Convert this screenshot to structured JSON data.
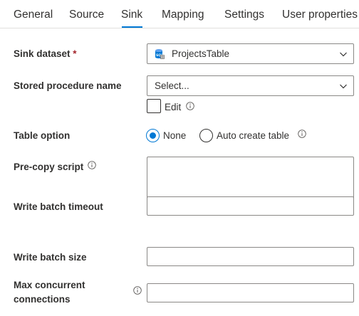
{
  "tabs": [
    {
      "label": "General"
    },
    {
      "label": "Source"
    },
    {
      "label": "Sink"
    },
    {
      "label": "Mapping"
    },
    {
      "label": "Settings"
    },
    {
      "label": "User properties"
    }
  ],
  "active_tab": "Sink",
  "accent_color": "#0078d4",
  "sink_dataset": {
    "label": "Sink dataset",
    "required_marker": "*",
    "value": "ProjectsTable",
    "icon": "sql-table-icon"
  },
  "stored_procedure": {
    "label": "Stored procedure name",
    "placeholder": "Select...",
    "edit_label": "Edit",
    "edit_checked": false
  },
  "table_option": {
    "label": "Table option",
    "options": [
      {
        "label": "None",
        "selected": true
      },
      {
        "label": "Auto create table",
        "selected": false
      }
    ]
  },
  "pre_copy_script": {
    "label": "Pre-copy script",
    "value": ""
  },
  "write_batch_timeout": {
    "label": "Write batch timeout",
    "value": ""
  },
  "write_batch_size": {
    "label": "Write batch size",
    "value": ""
  },
  "max_concurrent_connections": {
    "label_line1": "Max concurrent",
    "label_line2": "connections",
    "value": ""
  }
}
